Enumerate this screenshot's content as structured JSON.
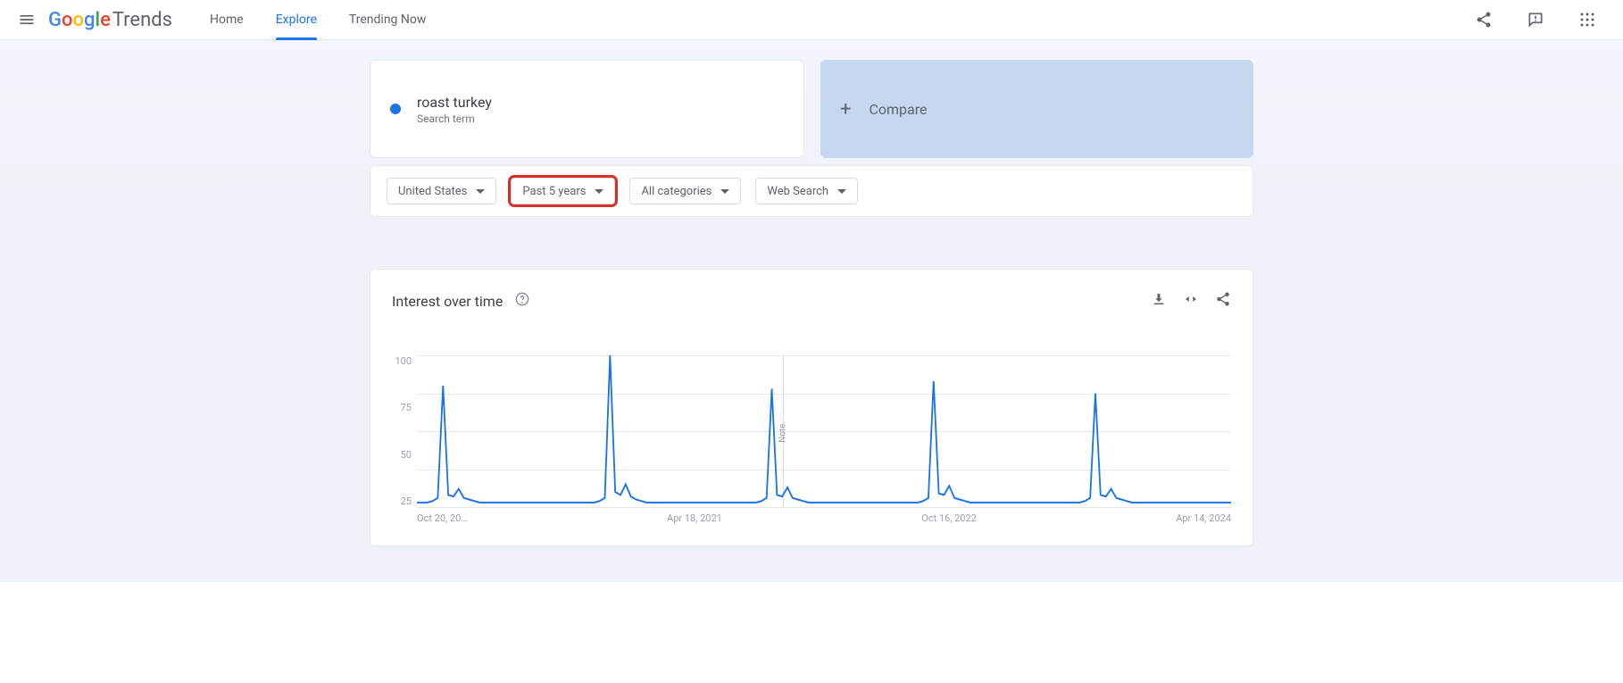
{
  "header": {
    "logo_brand": "Google",
    "logo_product": "Trends"
  },
  "nav": {
    "home": "Home",
    "explore": "Explore",
    "trending_now": "Trending Now"
  },
  "search_term": {
    "name": "roast turkey",
    "type": "Search term"
  },
  "compare": {
    "label": "Compare"
  },
  "filters": {
    "geo": "United States",
    "time": "Past 5 years",
    "category": "All categories",
    "search_type": "Web Search"
  },
  "chart": {
    "title": "Interest over time",
    "note_label": "Note"
  },
  "chart_data": {
    "type": "line",
    "xlabel": "",
    "ylabel": "",
    "ylim": [
      0,
      100
    ],
    "y_ticks": [
      100,
      75,
      50,
      25
    ],
    "x_ticks": [
      "Oct 20, 20…",
      "Apr 18, 2021",
      "Oct 16, 2022",
      "Apr 14, 2024"
    ],
    "series": [
      {
        "name": "roast turkey",
        "color": "#1a73e8",
        "values": [
          3,
          3,
          3,
          4,
          6,
          80,
          8,
          7,
          12,
          6,
          5,
          4,
          3,
          3,
          3,
          3,
          3,
          3,
          3,
          3,
          3,
          3,
          3,
          3,
          3,
          3,
          3,
          3,
          3,
          3,
          3,
          3,
          3,
          3,
          3,
          4,
          6,
          100,
          10,
          8,
          15,
          7,
          5,
          4,
          3,
          3,
          3,
          3,
          3,
          3,
          3,
          3,
          3,
          3,
          3,
          3,
          3,
          3,
          3,
          3,
          3,
          3,
          3,
          3,
          3,
          3,
          4,
          6,
          78,
          8,
          7,
          13,
          6,
          5,
          4,
          3,
          3,
          3,
          3,
          3,
          3,
          3,
          3,
          3,
          3,
          3,
          3,
          3,
          3,
          3,
          3,
          3,
          3,
          3,
          3,
          3,
          3,
          4,
          6,
          83,
          9,
          8,
          14,
          6,
          5,
          4,
          3,
          3,
          3,
          3,
          3,
          3,
          3,
          3,
          3,
          3,
          3,
          3,
          3,
          3,
          3,
          3,
          3,
          3,
          3,
          3,
          3,
          3,
          4,
          6,
          75,
          8,
          7,
          12,
          6,
          5,
          4,
          3,
          3,
          3,
          3,
          3,
          3,
          3,
          3,
          3,
          3,
          3,
          3,
          3,
          3,
          3,
          3,
          3,
          3,
          3,
          3
        ]
      }
    ]
  }
}
